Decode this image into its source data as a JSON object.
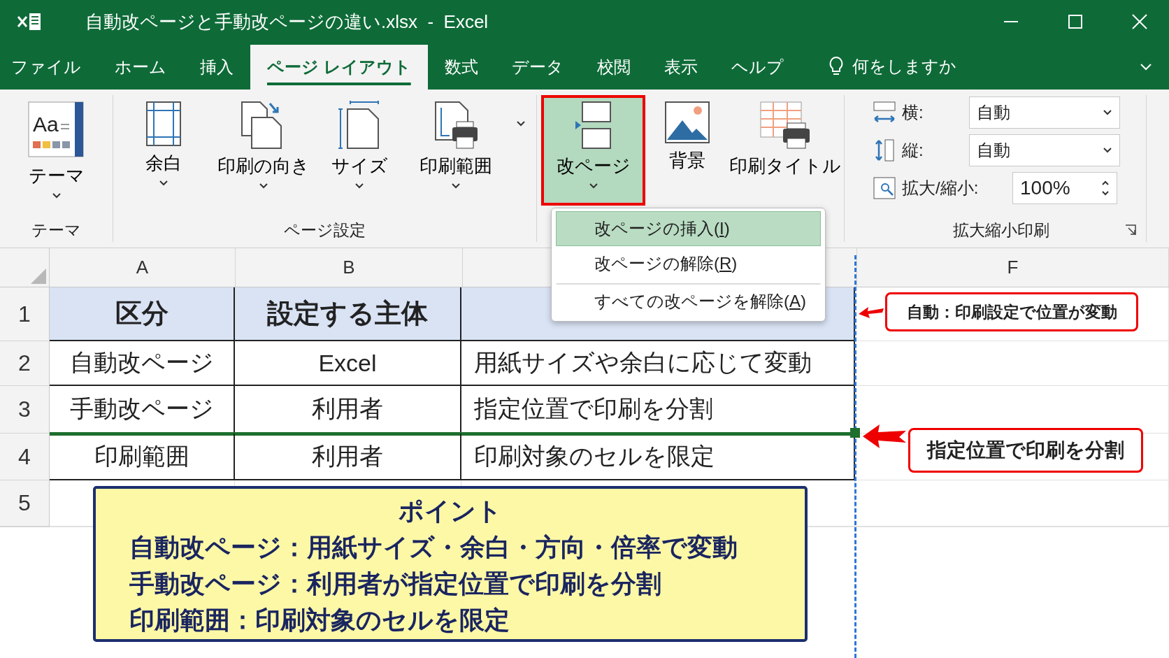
{
  "window": {
    "title": "自動改ページと手動改ページの違い.xlsx  -  Excel"
  },
  "tabs": [
    {
      "label": "ファイル",
      "selected": false
    },
    {
      "label": "ホーム",
      "selected": false
    },
    {
      "label": "挿入",
      "selected": false
    },
    {
      "label": "ページ レイアウト",
      "selected": true
    },
    {
      "label": "数式",
      "selected": false
    },
    {
      "label": "データ",
      "selected": false
    },
    {
      "label": "校閲",
      "selected": false
    },
    {
      "label": "表示",
      "selected": false
    },
    {
      "label": "ヘルプ",
      "selected": false
    }
  ],
  "tell_me": {
    "placeholder": "何をしますか"
  },
  "ribbon": {
    "groups": [
      {
        "label": "テーマ",
        "buttons": [
          {
            "kind": "large",
            "icon_text": "Aa",
            "label": "テーマ",
            "dropdown": true,
            "selected": false
          }
        ]
      },
      {
        "label": "ページ設定",
        "buttons": [
          {
            "kind": "large",
            "label": "余白",
            "dropdown": true,
            "selected": false
          },
          {
            "kind": "large",
            "label": "印刷の向き",
            "dropdown": true,
            "selected": false
          },
          {
            "kind": "large",
            "label": "サイズ",
            "dropdown": true,
            "selected": false
          },
          {
            "kind": "large",
            "label": "印刷範囲",
            "dropdown": true,
            "selected": false
          },
          {
            "kind": "more",
            "dropdown": true,
            "selected": false
          }
        ]
      },
      {
        "buttons": [
          {
            "kind": "large",
            "label": "改ページ",
            "dropdown": true,
            "selected": true
          },
          {
            "kind": "large",
            "label": "背景",
            "dropdown": false,
            "selected": false
          },
          {
            "kind": "large",
            "label": "印刷タイトル",
            "dropdown": false,
            "selected": false
          }
        ]
      }
    ],
    "scale": {
      "label": "拡大縮小印刷",
      "fields": [
        {
          "kind": "select",
          "label": "横:",
          "value": "自動"
        },
        {
          "kind": "select",
          "label": "縦:",
          "value": "自動"
        },
        {
          "kind": "spin",
          "label": "拡大/縮小:",
          "value": "100%"
        }
      ]
    }
  },
  "menu": {
    "items": [
      {
        "before": "改ページの挿入(",
        "key": "I",
        "after": ")",
        "selected": true,
        "separator_before": false
      },
      {
        "before": "改ページの解除(",
        "key": "R",
        "after": ")",
        "selected": false,
        "separator_before": false
      },
      {
        "before": "すべての改ページを解除(",
        "key": "A",
        "after": ")",
        "selected": false,
        "separator_before": true
      }
    ]
  },
  "sheet": {
    "columns": [
      {
        "header": "A"
      },
      {
        "header": "B"
      },
      {},
      {
        "header": "F"
      }
    ],
    "rows": [
      {
        "number": "1",
        "kind": "header",
        "cells": [
          "区分",
          "設定する主体"
        ],
        "page_break_after": false
      },
      {
        "number": "2",
        "kind": "data",
        "cells": [
          "自動改ページ",
          "Excel",
          "用紙サイズや余白に応じて変動"
        ],
        "page_break_after": false
      },
      {
        "number": "3",
        "kind": "data",
        "cells": [
          "手動改ページ",
          "利用者",
          "指定位置で印刷を分割"
        ],
        "page_break_after": true
      },
      {
        "number": "4",
        "kind": "data",
        "cells": [
          "印刷範囲",
          "利用者",
          "印刷対象のセルを限定"
        ],
        "page_break_after": false
      },
      {
        "number": "5",
        "kind": "empty",
        "cells": [],
        "page_break_after": false
      }
    ]
  },
  "callouts": [
    {
      "text": "自動：印刷設定で位置が変動"
    },
    {
      "text": "指定位置で印刷を分割"
    }
  ],
  "point": {
    "title": "ポイント",
    "lines": [
      "自動改ページ：用紙サイズ・余白・方向・倍率で変動",
      "手動改ページ：利用者が指定位置で印刷を分割",
      "印刷範囲：印刷対象のセルを限定"
    ]
  }
}
